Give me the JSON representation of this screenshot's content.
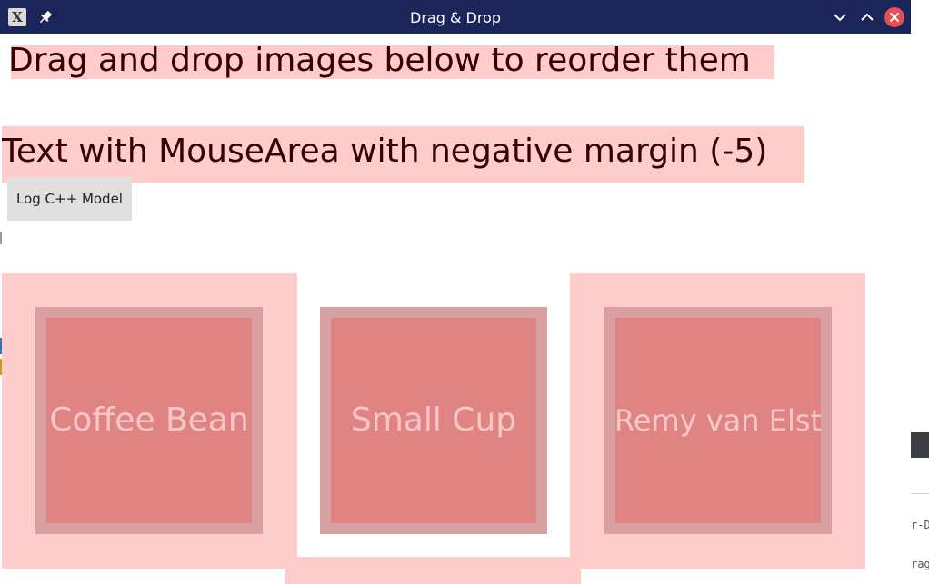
{
  "window": {
    "title": "Drag & Drop"
  },
  "header": {
    "instruction": "Drag and drop images below to reorder them",
    "mousearea_text": "Text with MouseArea with negative margin (-5)"
  },
  "toolbar": {
    "log_button_label": "Log C++ Model"
  },
  "tiles": [
    {
      "label": "Coffee Bean"
    },
    {
      "label": "Small Cup"
    },
    {
      "label": "Remy van Elst"
    }
  ],
  "background_window": {
    "fragment_1": "r-D",
    "fragment_2": "rag"
  },
  "colors": {
    "titlebar": "#1b2559",
    "highlight": "#ffcccc",
    "tile_frame": "#d8a0a0",
    "tile_inner": "#e08383",
    "tile_text": "#f7c7c7",
    "close_button": "#e94e55",
    "heading_text": "#3a0000"
  },
  "icons": {
    "app": "qt-app-icon",
    "pin": "pin-icon",
    "minimize": "chevron-down-icon",
    "maximize": "chevron-up-icon",
    "close": "close-icon"
  }
}
